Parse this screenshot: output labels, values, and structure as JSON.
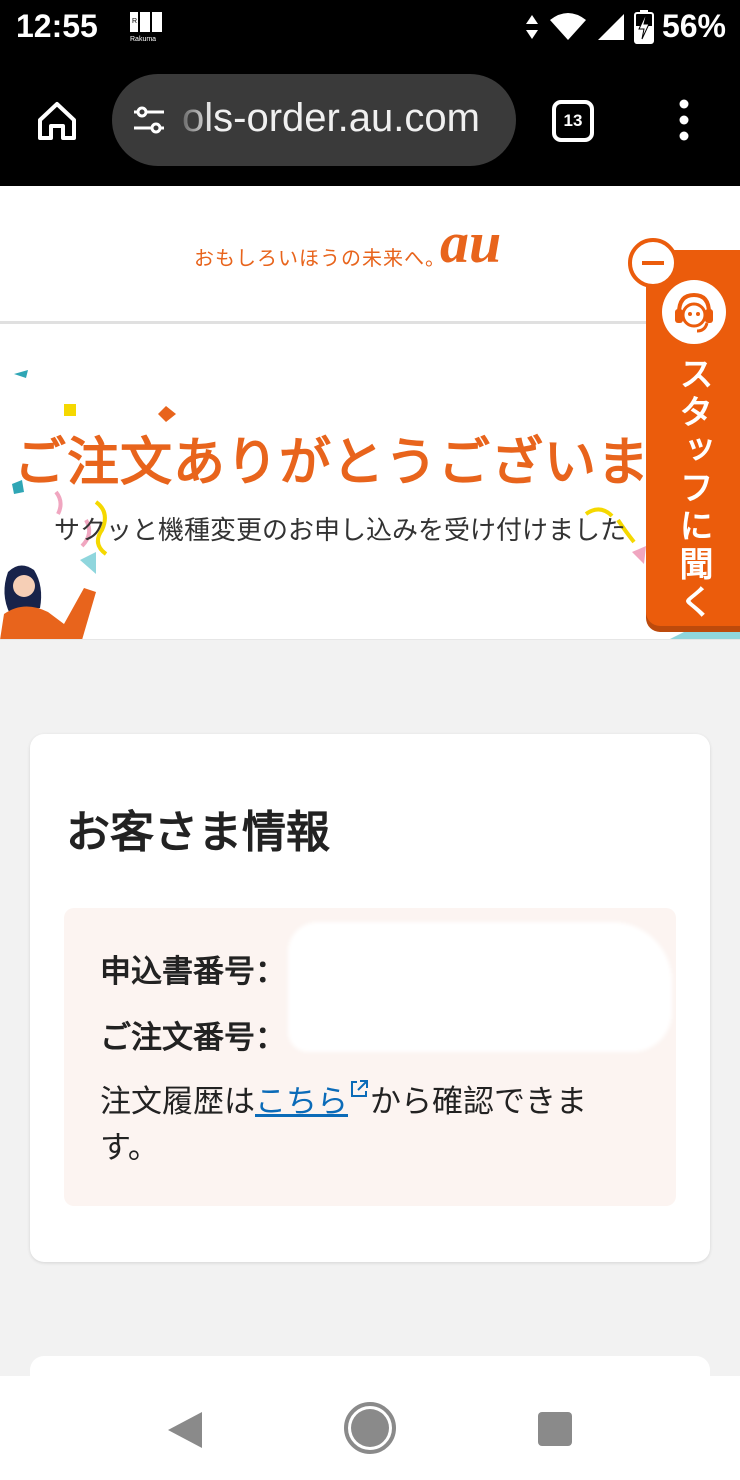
{
  "status_bar": {
    "time": "12:55",
    "app_icon_label": "Rakuma",
    "battery_percent": "56%",
    "icons": [
      "data-arrows-icon",
      "wifi-icon",
      "signal-icon",
      "battery-charging-icon"
    ]
  },
  "browser": {
    "url": "ols-order.au.com",
    "tab_count": "13"
  },
  "header": {
    "slogan": "おもしろいほうの未来へ。",
    "logo_text": "au",
    "brand_color": "#e8641c"
  },
  "hero": {
    "title": "ご注文ありがとうございま",
    "subtitle": "サクッと機種変更のお申し込みを受け付けました"
  },
  "chat_tab": {
    "label": "スタッフに聞く"
  },
  "customer_info": {
    "title": "お客さま情報",
    "application_number_label": "申込書番号：",
    "order_number_label": "ご注文番号：",
    "history_prefix": "注文履歴は",
    "history_link": "こちら",
    "history_suffix": "から確認できます。"
  },
  "nav": {
    "icons": [
      "back-icon",
      "home-icon",
      "recent-apps-icon"
    ]
  }
}
